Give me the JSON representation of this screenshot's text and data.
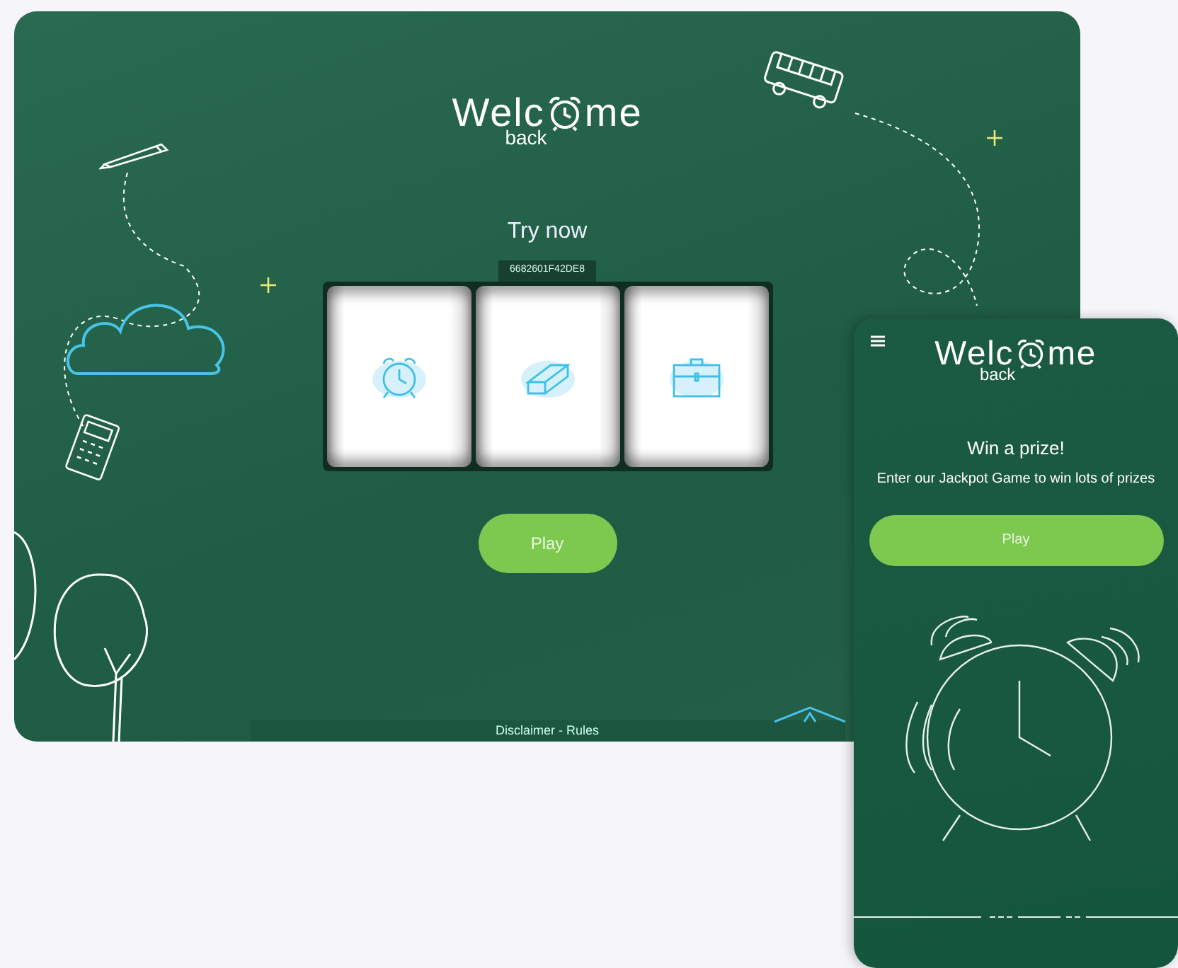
{
  "tablet": {
    "logo": {
      "part_1": "Welc",
      "part_2": "me",
      "subtitle": "back"
    },
    "heading": "Try now",
    "code": "6682601F42DE8",
    "reels": [
      {
        "kind": "alarm-clock"
      },
      {
        "kind": "eraser"
      },
      {
        "kind": "briefcase"
      }
    ],
    "play_button": "Play",
    "footer": "Disclaimer - Rules"
  },
  "phone": {
    "logo": {
      "part_1": "Welc",
      "part_2": "me",
      "subtitle": "back"
    },
    "heading": "Win a prize!",
    "subtitle": "Enter our Jackpot Game to win lots of prizes",
    "play_button": "Play"
  }
}
